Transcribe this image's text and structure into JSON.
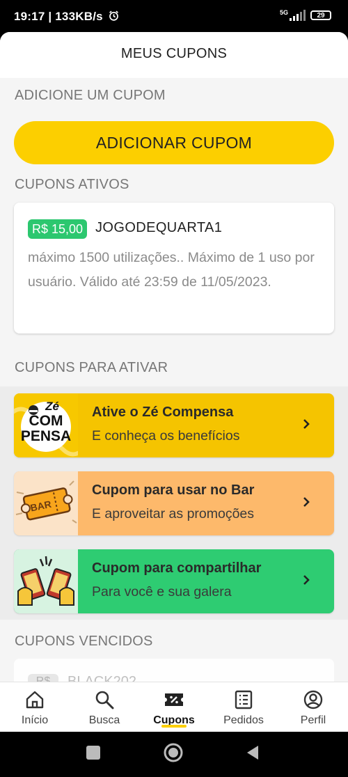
{
  "status": {
    "left": "19:17 | 133KB/s",
    "network": "5G",
    "battery": "29"
  },
  "header": {
    "title": "MEUS CUPONS"
  },
  "add_section": {
    "label": "ADICIONE UM CUPOM",
    "button": "ADICIONAR CUPOM"
  },
  "active_section": {
    "label": "CUPONS ATIVOS",
    "coupon": {
      "value": "R$ 15,00",
      "code": "JOGODEQUARTA1",
      "description": "máximo 1500 utilizações.. Máximo de 1 uso por usuário. Válido até 23:59 de 11/05/2023."
    }
  },
  "to_activate_section": {
    "label": "CUPONS PARA ATIVAR",
    "items": [
      {
        "title": "Ative o Zé Compensa",
        "subtitle": "E conheça os benefícios",
        "bg": "#f5c400",
        "img_bg": "#f7c800",
        "logo_text": [
          "Zé",
          "COM",
          "PENSA"
        ]
      },
      {
        "title": "Cupom para usar no Bar",
        "subtitle": "E aproveitar as promoções",
        "bg": "#fdb96b",
        "img_bg": "#fbe3c8",
        "logo_text": [
          "BAR"
        ]
      },
      {
        "title": "Cupom para compartilhar",
        "subtitle": "Para você e sua galera",
        "bg": "#2ecc72",
        "img_bg": "#d7f3e1"
      }
    ]
  },
  "expired_section": {
    "label": "CUPONS VENCIDOS",
    "coupon": {
      "value": "R$",
      "code": "BLACK202"
    }
  },
  "nav": {
    "items": [
      {
        "label": "Início",
        "icon": "home-icon"
      },
      {
        "label": "Busca",
        "icon": "search-icon"
      },
      {
        "label": "Cupons",
        "icon": "coupon-icon",
        "active": true
      },
      {
        "label": "Pedidos",
        "icon": "orders-icon"
      },
      {
        "label": "Perfil",
        "icon": "profile-icon"
      }
    ]
  },
  "colors": {
    "accent": "#fccf00",
    "badge_green": "#2cc76f"
  }
}
